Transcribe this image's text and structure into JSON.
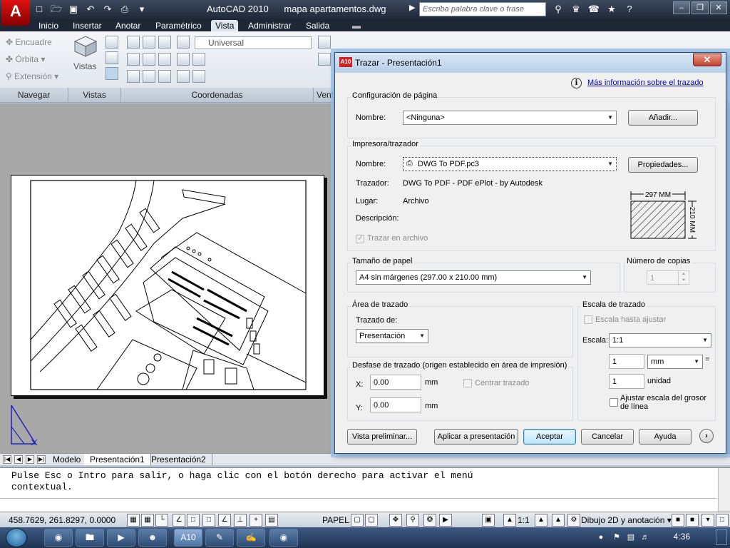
{
  "app": {
    "logo": "A",
    "title": "AutoCAD 2010",
    "document": "mapa apartamentos.dwg",
    "search_placeholder": "Escriba palabra clave o frase"
  },
  "ribbon": {
    "tabs": [
      "Inicio",
      "Insertar",
      "Anotar",
      "Paramétrico",
      "Vista",
      "Administrar",
      "Salida"
    ],
    "active_tab": "Vista",
    "navigate": {
      "items": [
        "Encuadre",
        "Órbita",
        "Extensión"
      ]
    },
    "views_label": "Vistas",
    "ucs_combo": "Universal",
    "panels": [
      "Navegar",
      "Vistas",
      "Coordenadas",
      "Vent"
    ]
  },
  "layout_tabs": [
    "Modelo",
    "Presentación1",
    "Presentación2"
  ],
  "command_line": {
    "text": "Pulse Esc o Intro para salir, o haga clic con el botón derecho para activar el menú contextual."
  },
  "status": {
    "coords": "458.7629, 261.8297, 0.0000",
    "papel": "PAPEL",
    "scale": "1:1",
    "workspace": "Dibujo 2D y anotación"
  },
  "taskbar": {
    "clock": "4:36",
    "app_button": "A10"
  },
  "dialog": {
    "title": "Trazar - Presentación1",
    "icon": "A10",
    "info_link": "Más información sobre el trazado",
    "page_setup": {
      "label": "Configuración de página",
      "name_label": "Nombre:",
      "name_value": "<Ninguna>",
      "add_button": "Añadir..."
    },
    "printer": {
      "label": "Impresora/trazador",
      "name_label": "Nombre:",
      "name_value": "DWG To PDF.pc3",
      "properties_button": "Propiedades...",
      "plotter_label": "Trazador:",
      "plotter_value": "DWG To PDF - PDF ePlot - by Autodesk",
      "where_label": "Lugar:",
      "where_value": "Archivo",
      "description_label": "Descripción:",
      "plot_to_file": "Trazar en archivo",
      "preview_width": "297 MM",
      "preview_height": "210 MM"
    },
    "paper_size": {
      "label": "Tamaño de papel",
      "value": "A4 sin márgenes (297.00 x 210.00 mm)"
    },
    "copies": {
      "label": "Número de copias",
      "value": "1"
    },
    "plot_area": {
      "label": "Área de trazado",
      "what_label": "Trazado de:",
      "what_value": "Presentación"
    },
    "plot_offset": {
      "label": "Desfase de trazado (origen establecido en área de impresión)",
      "x_label": "X:",
      "x_value": "0.00",
      "y_label": "Y:",
      "y_value": "0.00",
      "unit": "mm",
      "center": "Centrar trazado"
    },
    "plot_scale": {
      "label": "Escala de trazado",
      "fit": "Escala hasta ajustar",
      "scale_label": "Escala:",
      "scale_value": "1:1",
      "value1": "1",
      "unit_combo": "mm",
      "equals": "=",
      "value2": "1",
      "unit_label": "unidad",
      "lineweights": "Ajustar escala del grosor de línea"
    },
    "buttons": {
      "preview": "Vista preliminar...",
      "apply": "Aplicar a presentación",
      "ok": "Aceptar",
      "cancel": "Cancelar",
      "help": "Ayuda",
      "more": "›"
    }
  }
}
